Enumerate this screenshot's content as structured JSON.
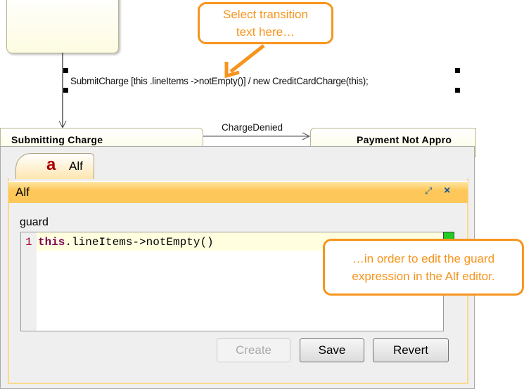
{
  "diagram": {
    "transition_label": "SubmitCharge [this .lineItems ->notEmpty()] / new  CreditCardCharge(this);",
    "states": {
      "left": "Submitting Charge",
      "right": "Payment Not Appro"
    },
    "charge_denied": "ChargeDenied"
  },
  "callouts": {
    "top": [
      "Select transition",
      "text here…"
    ],
    "right": [
      "…in order to edit the guard",
      "expression in the Alf editor."
    ]
  },
  "panel": {
    "tab_icon": "a",
    "tab_label": "Alf",
    "header_title": "Alf",
    "field_label": "guard",
    "code": {
      "line_number": "1",
      "keyword": "this",
      "rest": ".lineItems->notEmpty()"
    },
    "status_color": "#22cc22",
    "buttons": {
      "create": "Create",
      "save": "Save",
      "revert": "Revert"
    }
  },
  "colors": {
    "accent": "#f7941d",
    "header": "#fec75a"
  }
}
